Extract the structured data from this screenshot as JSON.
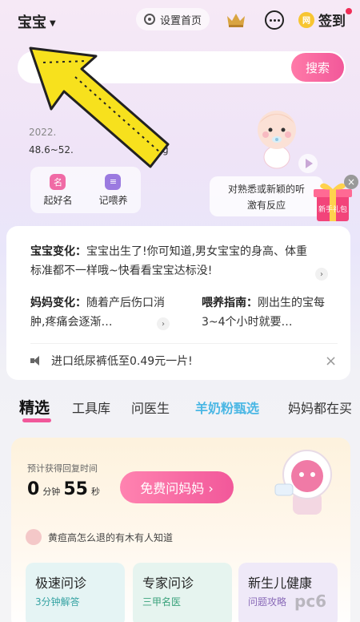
{
  "header": {
    "baby_selector": "宝宝",
    "set_home_label": "设置首页",
    "signin_label": "签到",
    "coin_glyph": "网"
  },
  "search": {
    "placeholder": "",
    "button_label": "搜索"
  },
  "baby_info": {
    "date": "2022.",
    "size": "48.6~52.",
    "weight_unit": "kg"
  },
  "tools": [
    {
      "icon": "名",
      "label": "起好名",
      "color": "#f06aa5"
    },
    {
      "icon": "≡",
      "label": "记喂养",
      "color": "#9b7ae0"
    }
  ],
  "tip": {
    "line1": "对熟悉或新颖的听",
    "line2": "激有反应"
  },
  "gift_label": "新手礼包",
  "news": {
    "main_title": "宝宝变化：",
    "main_text": "宝宝出生了!你可知道,男女宝宝的身高、体重标准都不一样哦~快看看宝宝达标没!",
    "mom_title": "妈妈变化：",
    "mom_text": "随着产后伤口消肿,疼痛会逐渐…",
    "feed_title": "喂养指南：",
    "feed_text": "刚出生的宝每3~4个小时就要…",
    "notice": "进口纸尿裤低至0.49元一片!"
  },
  "tabs": [
    {
      "label": "精选",
      "active": true
    },
    {
      "label": "工具库"
    },
    {
      "label": "问医生"
    },
    {
      "label": "羊奶粉甄选",
      "special": true
    },
    {
      "label": "妈妈都在买"
    }
  ],
  "consult": {
    "eta_label": "预计获得回复时间",
    "minutes": "0",
    "minutes_unit": "分钟",
    "seconds": "55",
    "seconds_unit": "秒",
    "ask_button": "免费问妈妈 ›",
    "question": "黄疸高怎么退的有木有人知道",
    "services": [
      {
        "title": "极速问诊",
        "sub": "3分钟解答"
      },
      {
        "title": "专家问诊",
        "sub": "三甲名医"
      },
      {
        "title": "新生儿健康",
        "sub": "问题攻略"
      }
    ]
  },
  "watermark": "pc6"
}
